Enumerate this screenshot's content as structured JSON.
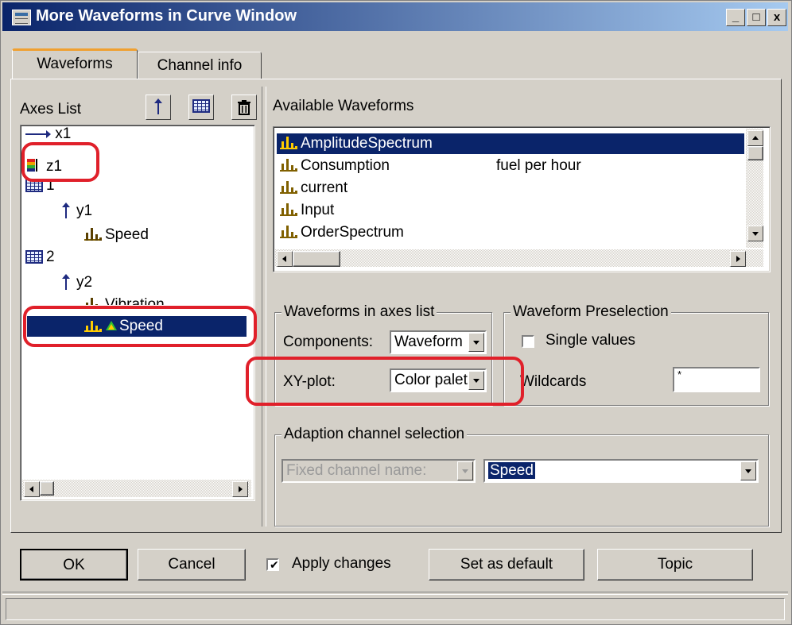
{
  "window": {
    "title": "More Waveforms in Curve Window",
    "minimize": "_",
    "maximize": "□",
    "close": "x"
  },
  "tabs": [
    {
      "label": "Waveforms",
      "active": true
    },
    {
      "label": "Channel info",
      "active": false
    }
  ],
  "axes": {
    "label": "Axes List",
    "toolbar": {
      "add_axis": "axis-add-icon",
      "add_grid": "grid-add-icon",
      "delete": "trash-icon"
    },
    "tree": {
      "x1": "x1",
      "z1": "z1",
      "g1": "1",
      "y1": "y1",
      "y1_wave": "Speed",
      "g2": "2",
      "y2": "y2",
      "y2_wave1": "Vibration",
      "y2_wave2": "Speed"
    }
  },
  "available": {
    "label": "Available Waveforms",
    "items": [
      {
        "name": "AmplitudeSpectrum",
        "desc": "",
        "selected": true
      },
      {
        "name": "Consumption",
        "desc": "fuel per hour",
        "selected": false
      },
      {
        "name": "current",
        "desc": "",
        "selected": false
      },
      {
        "name": "Input",
        "desc": "",
        "selected": false
      },
      {
        "name": "OrderSpectrum",
        "desc": "",
        "selected": false
      }
    ]
  },
  "waveforms_in_axes": {
    "title": "Waveforms in axes list",
    "components_label": "Components:",
    "components_value": "Waveform",
    "xyplot_label": "XY-plot:",
    "xyplot_value": "Color palet"
  },
  "preselection": {
    "title": "Waveform Preselection",
    "single_values": "Single values",
    "wildcards_label": "Wildcards",
    "wildcards_value": "*"
  },
  "adaption": {
    "title": "Adaption channel selection",
    "mode_value": "Fixed channel name:",
    "channel_value": "Speed"
  },
  "buttons": {
    "ok": "OK",
    "cancel": "Cancel",
    "apply": "Apply changes",
    "set_default": "Set as default",
    "topic": "Topic"
  },
  "colors": {
    "title_start": "#0a246a",
    "selection": "#0a246a",
    "highlight_mark": "#e0202a",
    "face": "#d4d0c8"
  }
}
